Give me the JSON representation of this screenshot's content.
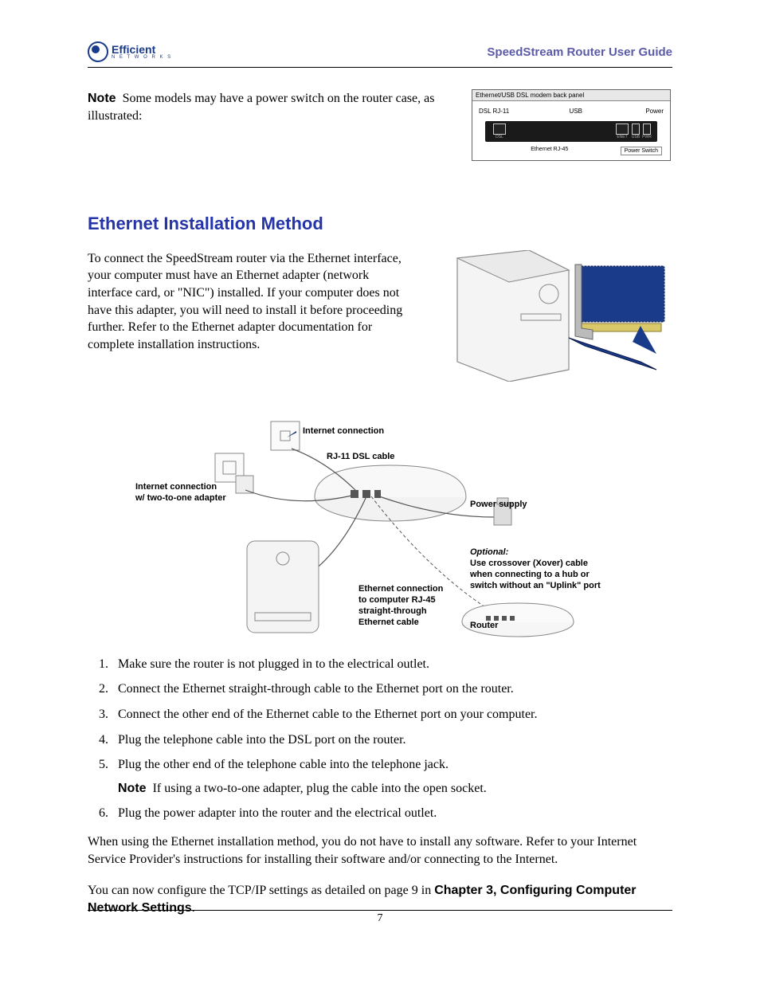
{
  "header": {
    "logo_main": "Efficient",
    "logo_sub": "N E T W O R K S",
    "title": "SpeedStream Router User Guide"
  },
  "note_block": {
    "label": "Note",
    "text": "Some models may have a power switch on the router case, as illustrated:"
  },
  "panel": {
    "title": "Ethernet/USB DSL modem back panel",
    "label_dsl": "DSL RJ-11",
    "label_usb": "USB",
    "label_power": "Power",
    "port_dsl": "DSL",
    "port_enet": "ENET",
    "port_usb": "USB",
    "port_pwr": "PWR",
    "bottom_label": "Ethernet RJ-45",
    "power_switch": "Power Switch"
  },
  "section_title": "Ethernet Installation Method",
  "intro": "To connect the SpeedStream router via the Ethernet interface, your computer must have an Ethernet adapter (network interface card, or \"NIC\") installed. If your computer does not have this adapter, you will need to install it before proceeding further. Refer to the Ethernet adapter documentation for complete installation instructions.",
  "diagram_labels": {
    "internet_connection": "Internet connection",
    "rj11": "RJ-11 DSL cable",
    "two_to_one_1": "Internet connection",
    "two_to_one_2": "w/ two-to-one adapter",
    "power_supply": "Power supply",
    "optional": "Optional:",
    "optional_l1": "Use crossover (Xover) cable",
    "optional_l2": "when connecting to a hub or",
    "optional_l3": "switch without an \"Uplink\" port",
    "eth_conn_1": "Ethernet connection",
    "eth_conn_2": "to computer RJ-45",
    "eth_conn_3": "straight-through",
    "eth_conn_4": "Ethernet cable",
    "router": "Router"
  },
  "steps": [
    "Make sure the router is not plugged in to the electrical outlet.",
    "Connect the Ethernet straight-through cable to the Ethernet port on the router.",
    "Connect the other end of the Ethernet cable to the Ethernet port on your computer.",
    "Plug the telephone cable into the DSL port on the router.",
    "Plug the other end of the telephone cable into the telephone jack.",
    "Plug the power adapter into the router and the electrical outlet."
  ],
  "step5_note": {
    "label": "Note",
    "text": "If using a two-to-one adapter, plug the cable into the open socket."
  },
  "closing1": "When using the Ethernet installation method, you do not have to install any software. Refer to your Internet Service Provider's instructions for installing their software and/or connecting to the Internet.",
  "closing2_pre": "You can now configure the TCP/IP settings as detailed on page 9 in ",
  "closing2_bold": "Chapter 3, Configuring Computer Network Settings",
  "closing2_post": ".",
  "page_number": "7"
}
